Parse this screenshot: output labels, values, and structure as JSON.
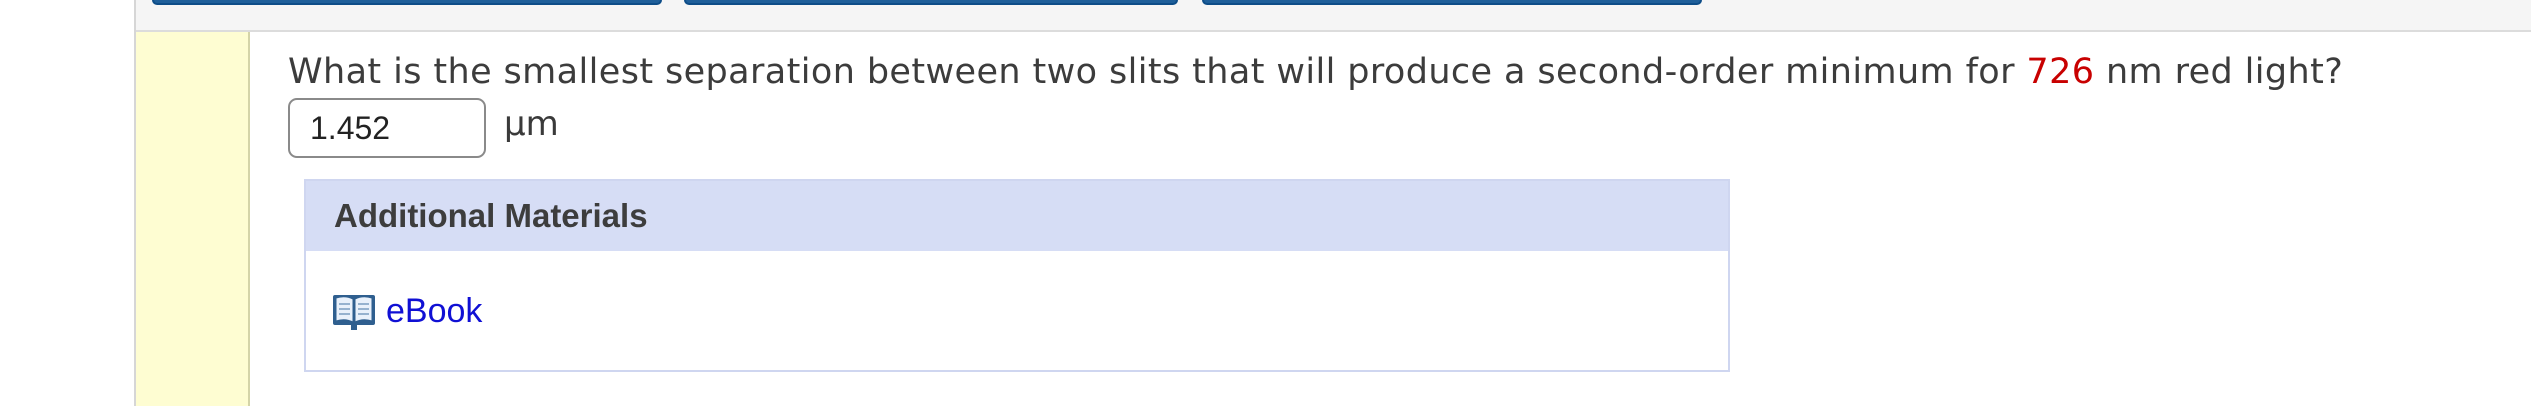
{
  "question": {
    "text_before": "What is the smallest separation between two slits that will produce a second-order minimum for ",
    "given_value": "726",
    "text_after": " nm red light?",
    "given_value_color": "#c80000"
  },
  "answer": {
    "value": "1.452",
    "unit": "µm"
  },
  "additional_materials": {
    "title": "Additional Materials",
    "items": [
      {
        "label": "eBook",
        "icon": "open-book-icon"
      }
    ]
  },
  "colors": {
    "tab_blue": "#1f5f9a",
    "rail_yellow": "#fefdd2",
    "materials_header": "#d6ddf5",
    "link_blue": "#1010d4"
  }
}
